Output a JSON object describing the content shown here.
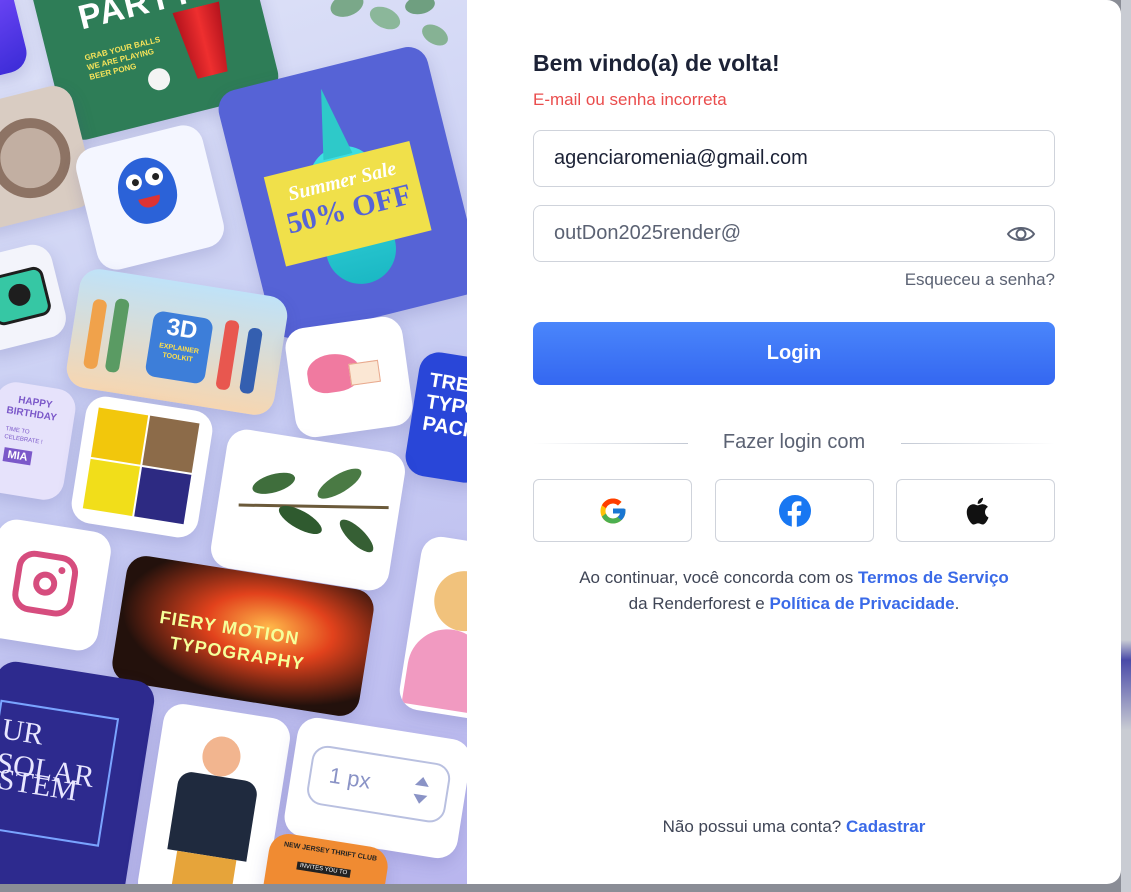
{
  "login": {
    "title": "Bem vindo(a) de volta!",
    "error": "E-mail ou senha incorreta",
    "email_value": "agenciaromenia@gmail.com",
    "password_value": "outDon2025render@",
    "forgot": "Esqueceu a senha?",
    "login_button": "Login",
    "divider": "Fazer login com",
    "social": [
      {
        "name": "google-icon"
      },
      {
        "name": "facebook-icon"
      },
      {
        "name": "apple-icon"
      }
    ],
    "terms": {
      "prefix": "Ao continuar, você concorda com os ",
      "tos_link": "Termos de Serviço",
      "middle": " da Renderforest e ",
      "privacy_link": "Política de Privacidade",
      "suffix": "."
    },
    "signup": {
      "prefix": "Não possui uma conta? ",
      "link": "Cadastrar"
    }
  },
  "collage": {
    "party_title": "PARTY",
    "party_text": "GRAB YOUR BALLS WE ARE PLAYING BEER PONG",
    "summer_sale_line1": "Summer Sale",
    "summer_sale_line2": "50% OFF",
    "explainer_big": "3D",
    "explainer_small": "EXPLAINER TOOLKIT",
    "birthday_line1": "HAPPY",
    "birthday_line2": "BIRTHDAY",
    "birthday_line3": "TIME TO CELEBRATE !",
    "birthday_name": "MIA",
    "typo_pack": "TREND TYPO PACK",
    "fiery_line1": "FIERY MOTION",
    "fiery_line2": "TYPOGRAPHY",
    "solar_line1": "UR SOLAR",
    "solar_line2": "STEM",
    "px_value": "1 px",
    "thrift": "NEW JERSEY THRIFT CLUB",
    "thrift_sub": "INVITES YOU TO"
  },
  "colors": {
    "primary": "#3a6ae8",
    "error": "#ea4d4d",
    "login_gradient_top": "#4a86fb",
    "login_gradient_bottom": "#3467f1",
    "facebook": "#1877f2"
  }
}
